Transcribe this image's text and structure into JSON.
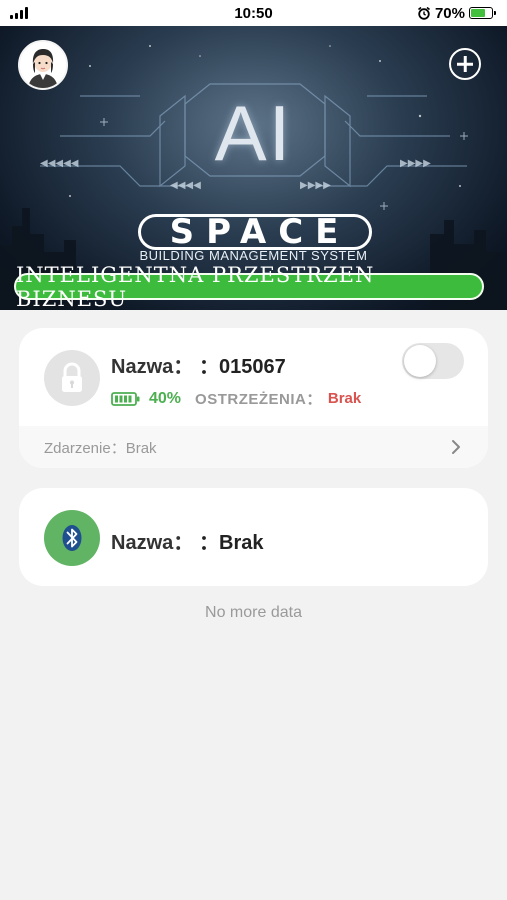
{
  "status_bar": {
    "time": "10:50",
    "battery_percent": "70%",
    "battery_level": 0.7,
    "icons": [
      "signal-icon",
      "alarm-icon",
      "battery-charging-icon"
    ]
  },
  "banner": {
    "ai_text": "AI",
    "logo_text": "SPACE",
    "subtitle": "BUILDING MANAGEMENT SYSTEM",
    "slogan": "INTELIGENTNA PRZESTRZEN BIZNESU",
    "icons": [
      "avatar-icon",
      "add-icon"
    ]
  },
  "devices": [
    {
      "name_label": "Nazwa：",
      "name_value": "：015067",
      "battery_pct": "40%",
      "battery_level": 0.4,
      "warnings_label": "OSTRZEŻENIA：",
      "warnings_value": "Brak",
      "event_label": "Zdarzenie：Brak",
      "toggle_on": false,
      "icon": "lock-icon"
    },
    {
      "name_label": "Nazwa：",
      "name_value": "：Brak",
      "icon": "bluetooth-icon"
    }
  ],
  "footer": {
    "no_more": "No more data"
  },
  "colors": {
    "accent_green": "#3dbb3d",
    "battery_green": "#4caf50",
    "warning_red": "#d9534f",
    "bluetooth_green": "#61b463",
    "page_bg": "#f2f2f2"
  }
}
